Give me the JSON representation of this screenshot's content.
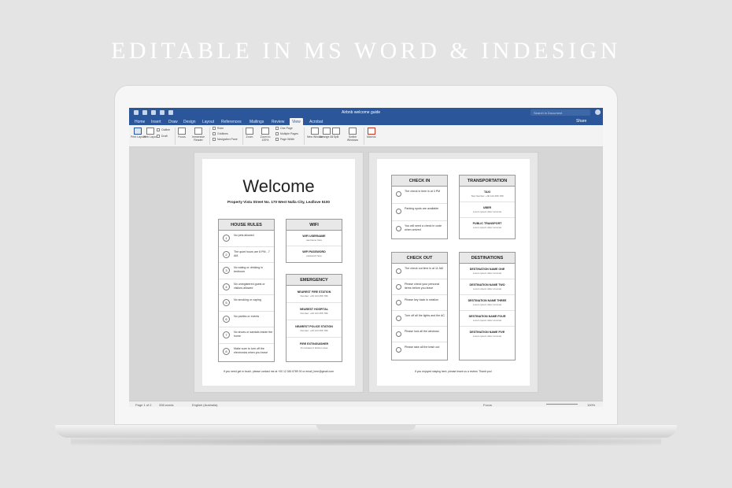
{
  "hero": {
    "headline": "EDITABLE IN MS WORD & INDESIGN"
  },
  "word": {
    "doc_title": "Airbnb welcome guide",
    "search_placeholder": "Search in Document",
    "tabs": [
      "Home",
      "Insert",
      "Draw",
      "Design",
      "Layout",
      "References",
      "Mailings",
      "Review",
      "View",
      "Acrobat"
    ],
    "active_tab": "View",
    "share_label": "Share",
    "ribbon": {
      "print_layout": "Print Layout",
      "web_layout": "Web Layout",
      "outline": "Outline",
      "draft": "Draft",
      "focus": "Focus",
      "immersive_reader": "Immersive Reader",
      "ruler": "Ruler",
      "gridlines": "Gridlines",
      "navigation_pane": "Navigation Pane",
      "zoom": "Zoom",
      "zoom_100": "Zoom to 100%",
      "one_page": "One Page",
      "multiple_pages": "Multiple Pages",
      "page_width": "Page Width",
      "new_window": "New Window",
      "arrange_all": "Arrange All",
      "split": "Split",
      "switch_windows": "Switch Windows",
      "macros": "Macros"
    },
    "status": {
      "page": "Page 1 of 2",
      "words": "338 words",
      "language": "English (Australia)",
      "focus": "Focus",
      "zoom": "100%"
    }
  },
  "page1": {
    "title": "Welcome",
    "address": "Property Vista Street No. 170 West Nulla City, Leafiove 5100",
    "house_rules": {
      "heading": "HOUSE RULES",
      "items": [
        {
          "num": "1",
          "text": "No pets allowed"
        },
        {
          "num": "2",
          "text": "The quiet hours are 8 PM - 7 AM"
        },
        {
          "num": "3",
          "text": "No eating or drinking in bedroom"
        },
        {
          "num": "4",
          "text": "No unregistered guest or visitors allowed"
        },
        {
          "num": "5",
          "text": "No smoking or vaping"
        },
        {
          "num": "6",
          "text": "No parties or events"
        },
        {
          "num": "7",
          "text": "No shoes or sandals inside the home"
        },
        {
          "num": "8",
          "text": "Make sure to turn off the electronics when you leave"
        }
      ]
    },
    "wifi": {
      "heading": "WIFI",
      "items": [
        {
          "title": "WIFI USERNAME",
          "sub": "username here"
        },
        {
          "title": "WIFI PASSWORD",
          "sub": "password here"
        }
      ]
    },
    "emergency": {
      "heading": "EMERGENCY",
      "items": [
        {
          "title": "NEAREST FIRE STATION",
          "sub": "Number: +00 123 456 789"
        },
        {
          "title": "NEAREST HOSPITAL",
          "sub": "Number: +00 123 456 789"
        },
        {
          "title": "NEAREST POLICE STATION",
          "sub": "Number: +00 123 456 789"
        },
        {
          "title": "FIRE EXTINGUISHER",
          "sub": "It's located in kitchen area"
        }
      ]
    },
    "footer": "If you need get in touch, please contact me at +00 12 345 6789 00 or email_here@gmail.com"
  },
  "page2": {
    "check_in": {
      "heading": "CHECK IN",
      "items": [
        "The check in time is at 3 PM",
        "Parking spots are available",
        "You will need a check in code when arrived"
      ]
    },
    "check_out": {
      "heading": "CHECK OUT",
      "items": [
        "The check out time is at 11 AM",
        "Please check your personal items before you leave",
        "Please key back in rotation",
        "Turn off all the lights and the AC",
        "Please lock all the windows",
        "Please take all the trash out"
      ]
    },
    "transportation": {
      "heading": "TRANSPORTATION",
      "items": [
        {
          "title": "TAXI",
          "sub": "Taxi Number: +00 123 456 789"
        },
        {
          "title": "UBER",
          "sub": "Lorem ipsum dolor sit amet"
        },
        {
          "title": "PUBLIC TRANSPORT",
          "sub": "Lorem ipsum dolor sit amet"
        }
      ]
    },
    "destinations": {
      "heading": "DESTINATIONS",
      "items": [
        {
          "title": "DESTINATION NAME ONE",
          "sub": "Lorem ipsum dolor sit amet"
        },
        {
          "title": "DESTINATION NAME TWO",
          "sub": "Lorem ipsum dolor sit amet"
        },
        {
          "title": "DESTINATION NAME THREE",
          "sub": "Lorem ipsum dolor sit amet"
        },
        {
          "title": "DESTINATION NAME FOUR",
          "sub": "Lorem ipsum dolor sit amet"
        },
        {
          "title": "DESTINATION NAME FIVE",
          "sub": "Lorem ipsum dolor sit amet"
        }
      ]
    },
    "footer": "If you enjoyed staying here, please leave us a review. Thank you!"
  }
}
